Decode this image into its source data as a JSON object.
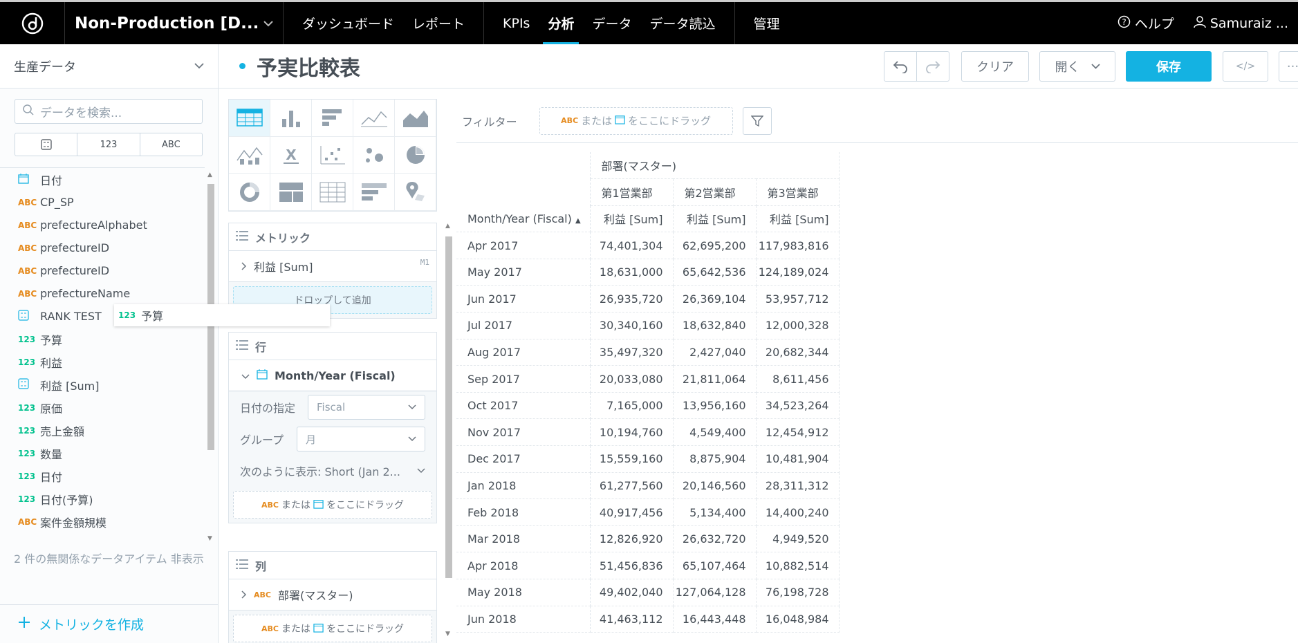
{
  "topbar": {
    "workspace": "Non-Production [D...",
    "nav_left": [
      "ダッシュボード",
      "レポート"
    ],
    "nav_mid": [
      "KPIs",
      "分析",
      "データ",
      "データ読込"
    ],
    "nav_admin": "管理",
    "help": "ヘルプ",
    "user": "Samuraiz ..."
  },
  "left": {
    "dataset": "生産データ",
    "search_placeholder": "データを検索...",
    "type_filters": [
      "",
      "123",
      "ABC"
    ],
    "items": [
      {
        "type": "date",
        "icon": "",
        "label": "日付"
      },
      {
        "type": "abc",
        "icon": "ABC",
        "label": "CP_SP"
      },
      {
        "type": "abc",
        "icon": "ABC",
        "label": "prefectureAlphabet"
      },
      {
        "type": "abc",
        "icon": "ABC",
        "label": "prefectureID"
      },
      {
        "type": "abc",
        "icon": "ABC",
        "label": "prefectureID"
      },
      {
        "type": "abc",
        "icon": "ABC",
        "label": "prefectureName"
      },
      {
        "type": "met",
        "icon": "",
        "label": "RANK TEST"
      },
      {
        "type": "num",
        "icon": "123",
        "label": "予算"
      },
      {
        "type": "num",
        "icon": "123",
        "label": "利益"
      },
      {
        "type": "met",
        "icon": "",
        "label": "利益 [Sum]"
      },
      {
        "type": "num",
        "icon": "123",
        "label": "原価"
      },
      {
        "type": "num",
        "icon": "123",
        "label": "売上金額"
      },
      {
        "type": "num",
        "icon": "123",
        "label": "数量"
      },
      {
        "type": "num",
        "icon": "123",
        "label": "日付"
      },
      {
        "type": "num",
        "icon": "123",
        "label": "日付(予算)"
      },
      {
        "type": "abc",
        "icon": "ABC",
        "label": "案件金額規模"
      }
    ],
    "unrelated": "2 件の無関係なデータアイテム 非表示",
    "create_metric": "メトリックを作成",
    "drag_ghost_icon": "123",
    "drag_ghost": "予算"
  },
  "header": {
    "title": "予実比較表",
    "clear": "クリア",
    "open": "開く",
    "save": "保存",
    "embed": "</>"
  },
  "buckets": {
    "metrics_title": "メトリック",
    "metric_item": "利益 [Sum]",
    "metric_tag": "M1",
    "metric_drop": "ドロップして追加",
    "rows_title": "行",
    "row_item": "Month/Year (Fiscal)",
    "date_spec_label": "日付の指定",
    "date_spec_value": "Fiscal",
    "group_label": "グループ",
    "group_value": "月",
    "display_as": "次のように表示: Short (Jan 2...",
    "drop_abc": "ABC",
    "drop_or": "または",
    "drop_here": "をここにドラッグ",
    "columns_title": "列",
    "col_item_icon": "ABC",
    "col_item": "部署(マスター)"
  },
  "filter": {
    "label": "フィルター"
  },
  "table": {
    "attr_header": "部署(マスター)",
    "row_header": "Month/Year (Fiscal)",
    "depts": [
      "第1営業部",
      "第2営業部",
      "第3営業部"
    ],
    "measure": "利益 [Sum]",
    "rows": [
      [
        "Apr 2017",
        "74,401,304",
        "62,695,200",
        "117,983,816"
      ],
      [
        "May 2017",
        "18,631,000",
        "65,642,536",
        "124,189,024"
      ],
      [
        "Jun 2017",
        "26,935,720",
        "26,369,104",
        "53,957,712"
      ],
      [
        "Jul 2017",
        "30,340,160",
        "18,632,840",
        "12,000,328"
      ],
      [
        "Aug 2017",
        "35,497,320",
        "2,427,040",
        "20,682,344"
      ],
      [
        "Sep 2017",
        "20,033,080",
        "21,811,064",
        "8,611,456"
      ],
      [
        "Oct 2017",
        "7,165,000",
        "13,956,160",
        "34,523,264"
      ],
      [
        "Nov 2017",
        "10,194,760",
        "4,549,400",
        "12,454,912"
      ],
      [
        "Dec 2017",
        "15,559,160",
        "8,875,904",
        "10,481,904"
      ],
      [
        "Jan 2018",
        "61,277,560",
        "20,146,560",
        "28,311,312"
      ],
      [
        "Feb 2018",
        "40,917,456",
        "5,134,400",
        "14,400,240"
      ],
      [
        "Mar 2018",
        "12,826,920",
        "26,632,720",
        "4,949,520"
      ],
      [
        "Apr 2018",
        "51,456,836",
        "65,107,464",
        "10,882,514"
      ],
      [
        "May 2018",
        "49,402,040",
        "127,064,128",
        "76,198,728"
      ],
      [
        "Jun 2018",
        "41,463,112",
        "16,443,448",
        "16,048,984"
      ]
    ]
  }
}
